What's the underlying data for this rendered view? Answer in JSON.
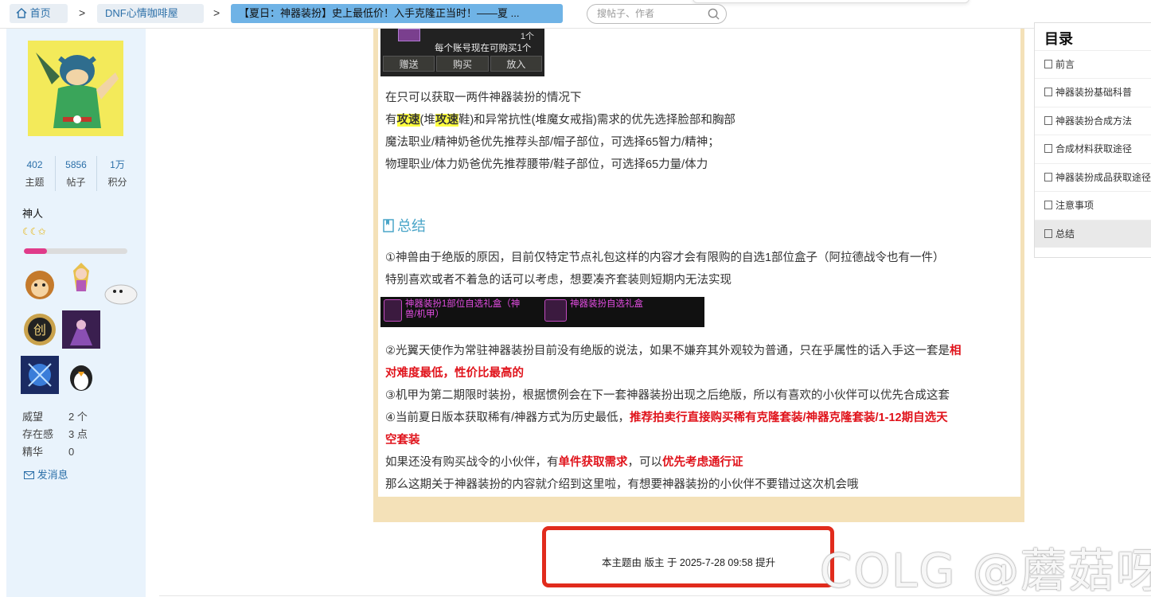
{
  "breadcrumb": {
    "home": "首页",
    "forum": "DNF心情咖啡屋",
    "thread": "【夏日：神器装扮】史上最低价！入手克隆正当时！——夏 ..."
  },
  "search": {
    "placeholder": "搜帖子、作者"
  },
  "profile": {
    "stats": [
      {
        "num": "402",
        "label": "主题"
      },
      {
        "num": "5856",
        "label": "帖子"
      },
      {
        "num": "1万",
        "label": "积分"
      }
    ],
    "username": "神人",
    "level_progress": 0.22,
    "attrs": [
      {
        "label": "威望",
        "value": "2 个"
      },
      {
        "label": "存在感",
        "value": "3 点"
      },
      {
        "label": "精华",
        "value": "0"
      }
    ],
    "send_message": "发消息"
  },
  "shop_widget": {
    "quantity": "1个",
    "limit": "每个账号现在可购买1个",
    "buttons": [
      "赠送",
      "购买",
      "放入"
    ]
  },
  "post": {
    "line1": "在只可以获取一两件神器装扮的情况下",
    "line2_a": "有",
    "line2_hl1": "攻速",
    "line2_b": "(堆",
    "line2_hl2": "攻速",
    "line2_c": "鞋)和异常抗性(堆魔女戒指)需求的优先选择脸部和胸部",
    "line3": "魔法职业/精神奶爸优先推荐头部/帽子部位，可选择65智力/精神；",
    "line4": "物理职业/体力奶爸优先推荐腰带/鞋子部位，可选择65力量/体力",
    "summary_heading": "总结",
    "s1": "①神兽由于绝版的原因，目前仅特定节点礼包这样的内容才会有限购的自选1部位盒子（阿拉德战令也有一件）",
    "s2": "特别喜欢或者不着急的话可以考虑，想要凑齐套装则短期内无法实现",
    "gift1": "神器装扮1部位自选礼盒（神兽/机甲）",
    "gift2": "神器装扮自选礼盒",
    "s3a": "②光翼天使作为常驻神器装扮目前没有绝版的说法，如果不嫌弃其外观较为普通，只在乎属性的话入手这一套是",
    "s3b": "相",
    "s3c": "对难度最低，性价比最高的",
    "s4": "③机甲为第二期限时装扮，根据惯例会在下一套神器装扮出现之后绝版，所以有喜欢的小伙伴可以优先合成这套",
    "s5a": "④当前夏日版本获取稀有/神器方式为历史最低，",
    "s5b": "推荐拍卖行直接购买稀有克隆套装/神器克隆套装/1-12期自选天",
    "s5c": "空套装",
    "s6a": "如果还没有购买战令的小伙伴，有",
    "s6b": "单件获取需求",
    "s6c": "，可以",
    "s6d": "优先考虑通行证",
    "s7": "那么这期关于神器装扮的内容就介绍到这里啦，有想要神器装扮的小伙伴不要错过这次机会哦"
  },
  "bump_note": "本主题由 版主 于 2025-7-28 09:58 提升",
  "watermark": "COLG @蘑菇呀",
  "toc": {
    "title": "目录",
    "items": [
      "前言",
      "神器装扮基础科普",
      "神器装扮合成方法",
      "合成材料获取途径",
      "神器装扮成品获取途径",
      "注意事项",
      "总结"
    ],
    "active_index": 6
  },
  "colors": {
    "link": "#2b6fa8",
    "accent_red": "#e0131b",
    "highlight": "#ffff40",
    "heading": "#4aa5c8"
  }
}
